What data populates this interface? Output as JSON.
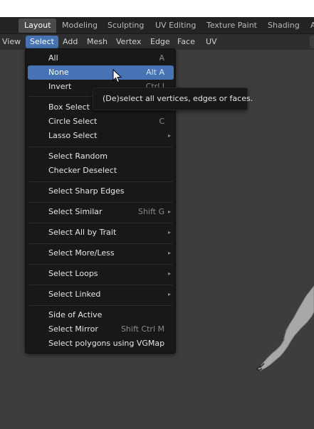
{
  "workspace_tabs": [
    "Layout",
    "Modeling",
    "Sculpting",
    "UV Editing",
    "Texture Paint",
    "Shading",
    "A"
  ],
  "header_menu": [
    "View",
    "Select",
    "Add",
    "Mesh",
    "Vertex",
    "Edge",
    "Face",
    "UV"
  ],
  "select_menu": {
    "all": {
      "label": "All",
      "shortcut": "A"
    },
    "none": {
      "label": "None",
      "shortcut": "Alt A"
    },
    "invert": {
      "label": "Invert",
      "shortcut": "Ctrl I"
    },
    "box_select": {
      "label": "Box Select"
    },
    "circle_select": {
      "label": "Circle Select",
      "shortcut": "C"
    },
    "lasso_select": {
      "label": "Lasso Select"
    },
    "select_random": {
      "label": "Select Random"
    },
    "checker_deselect": {
      "label": "Checker Deselect"
    },
    "select_sharp_edges": {
      "label": "Select Sharp Edges"
    },
    "select_similar": {
      "label": "Select Similar",
      "shortcut": "Shift G"
    },
    "select_all_by_trait": {
      "label": "Select All by Trait"
    },
    "select_more_less": {
      "label": "Select More/Less"
    },
    "select_loops": {
      "label": "Select Loops"
    },
    "select_linked": {
      "label": "Select Linked"
    },
    "side_of_active": {
      "label": "Side of Active"
    },
    "select_mirror": {
      "label": "Select Mirror",
      "shortcut": "Shift Ctrl M"
    },
    "select_vgmap": {
      "label": "Select polygons using VGMap"
    }
  },
  "submenu_arrow": "▸",
  "tooltip": "(De)select all vertices, edges or faces.",
  "colors": {
    "accent": "#4772b3",
    "menu_bg": "#181818",
    "viewport_bg": "#3d3d3d"
  }
}
